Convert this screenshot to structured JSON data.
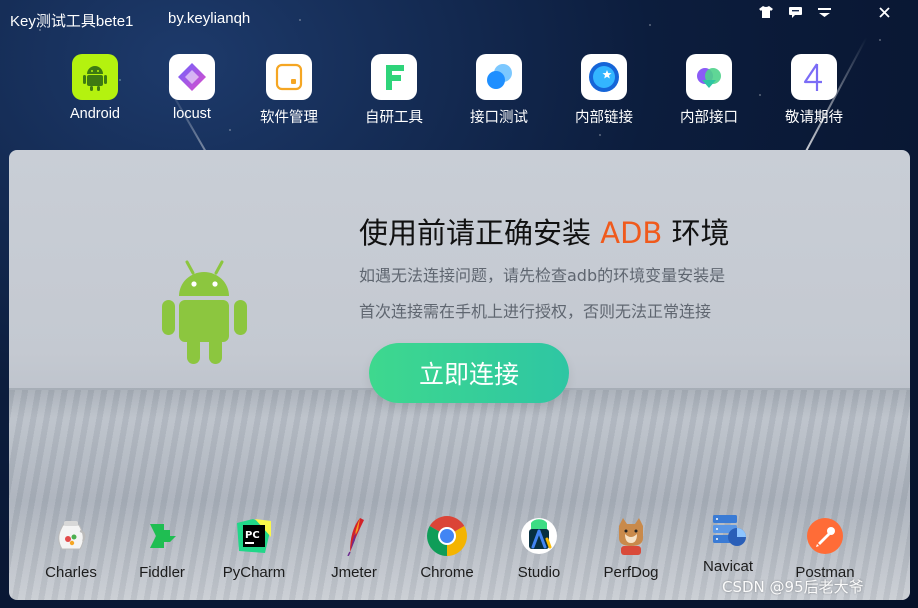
{
  "window": {
    "title": "Key测试工具bete1",
    "author": "by.keylianqh",
    "controls": [
      "shirt-icon",
      "message-icon",
      "menu-icon",
      "close-icon"
    ]
  },
  "nav": {
    "items": [
      {
        "label": "Android",
        "icon": "android-icon",
        "color": "#a6e22e"
      },
      {
        "label": "locust",
        "icon": "locust-icon",
        "color": "#8b5cf6"
      },
      {
        "label": "软件管理",
        "icon": "software-manage-icon",
        "color": "#f5a623"
      },
      {
        "label": "自研工具",
        "icon": "self-dev-tool-icon",
        "color": "#2ed47a"
      },
      {
        "label": "接口测试",
        "icon": "api-test-icon",
        "color": "#2f9bff"
      },
      {
        "label": "内部链接",
        "icon": "internal-link-icon",
        "color": "#1e88ff"
      },
      {
        "label": "内部接口",
        "icon": "internal-api-icon",
        "color": "#4fd18b"
      },
      {
        "label": "敬请期待",
        "icon": "coming-soon-icon",
        "color": "#7b6cf6"
      }
    ]
  },
  "main": {
    "heading_prefix": "使用前请正确安装",
    "heading_accent": "ADB",
    "heading_suffix": "环境",
    "line1": "如遇无法连接问题，请先检查adb的环境变量安装是",
    "line2": "首次连接需在手机上进行授权，否则无法正常连接",
    "connect_button": "立即连接",
    "accent_color": "#f05a1c",
    "button_color": "#36d09a"
  },
  "tools": [
    {
      "label": "Charles",
      "icon": "charles-icon"
    },
    {
      "label": "Fiddler",
      "icon": "fiddler-icon"
    },
    {
      "label": "PyCharm",
      "icon": "pycharm-icon"
    },
    {
      "label": "Jmeter",
      "icon": "jmeter-icon"
    },
    {
      "label": "Chrome",
      "icon": "chrome-icon"
    },
    {
      "label": "Studio",
      "icon": "android-studio-icon"
    },
    {
      "label": "PerfDog",
      "icon": "perfdog-icon"
    },
    {
      "label": "Navicat",
      "icon": "navicat-icon"
    },
    {
      "label": "Postman",
      "icon": "postman-icon"
    }
  ],
  "watermark": "CSDN @95后老大爷"
}
